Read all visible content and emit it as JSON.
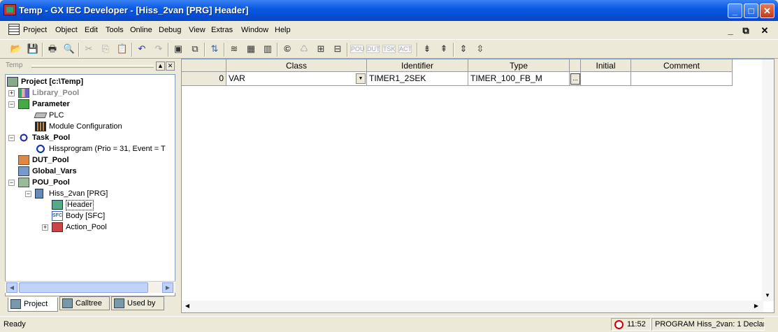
{
  "window": {
    "title": "Temp - GX IEC Developer - [Hiss_2van [PRG] Header]"
  },
  "menu": [
    "Project",
    "Object",
    "Edit",
    "Tools",
    "Online",
    "Debug",
    "View",
    "Extras",
    "Window",
    "Help"
  ],
  "left_panel": {
    "title": "Temp",
    "tree": [
      {
        "label": "Project [c:\\Temp]",
        "level": 0,
        "bold": true,
        "icon": "project-icon",
        "expander": ""
      },
      {
        "label": "Library_Pool",
        "level": 1,
        "bold": true,
        "grey": true,
        "icon": "library-icon",
        "expander": "+"
      },
      {
        "label": "Parameter",
        "level": 1,
        "bold": true,
        "icon": "parameter-icon",
        "expander": "−"
      },
      {
        "label": "PLC",
        "level": 2,
        "icon": "plc-icon",
        "expander": ""
      },
      {
        "label": "Module Configuration",
        "level": 2,
        "icon": "module-icon",
        "expander": ""
      },
      {
        "label": "Task_Pool",
        "level": 1,
        "bold": true,
        "icon": "task-icon",
        "expander": "−"
      },
      {
        "label": "Hissprogram (Prio = 31, Event = T",
        "level": 2,
        "icon": "clock-icon",
        "expander": ""
      },
      {
        "label": "DUT_Pool",
        "level": 1,
        "bold": true,
        "icon": "dut-icon",
        "expander": ""
      },
      {
        "label": "Global_Vars",
        "level": 1,
        "bold": true,
        "icon": "globals-icon",
        "expander": ""
      },
      {
        "label": "POU_Pool",
        "level": 1,
        "bold": true,
        "icon": "pou-icon",
        "expander": "−"
      },
      {
        "label": "Hiss_2van [PRG]",
        "level": 2,
        "icon": "program-icon",
        "expander": "−"
      },
      {
        "label": "Header",
        "level": 3,
        "selected": true,
        "icon": "header-icon",
        "expander": ""
      },
      {
        "label": "Body [SFC]",
        "level": 3,
        "icon": "sfc-icon",
        "expander": ""
      },
      {
        "label": "Action_Pool",
        "level": 3,
        "icon": "action-icon",
        "expander": "+"
      }
    ],
    "tabs": [
      "Project",
      "Calltree",
      "Used by"
    ]
  },
  "grid": {
    "columns": [
      "",
      "Class",
      "Identifier",
      "Type",
      "",
      "Initial",
      "Comment"
    ],
    "rows": [
      {
        "index": "0",
        "class": "VAR",
        "identifier": "TIMER1_2SEK",
        "type": "TIMER_100_FB_M",
        "initial": "",
        "comment": ""
      }
    ]
  },
  "status": {
    "ready": "Ready",
    "time": "11:52",
    "info": "PROGRAM Hiss_2van: 1 Declara"
  },
  "icons": {
    "sfc_label": "SFC"
  }
}
